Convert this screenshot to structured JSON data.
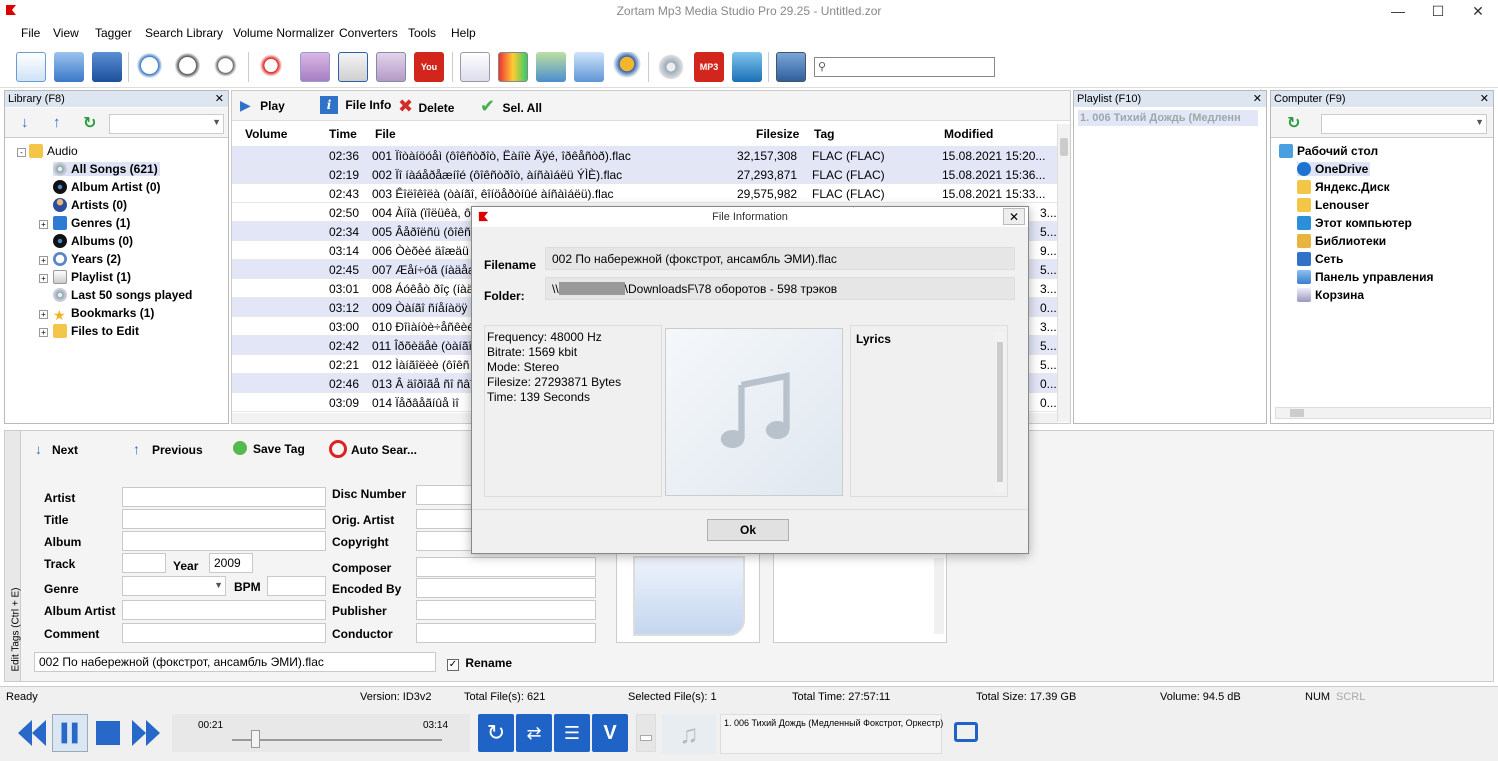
{
  "window": {
    "title": "Zortam Mp3 Media Studio Pro 29.25 - Untitled.zor"
  },
  "menu": [
    "File",
    "View",
    "Tagger",
    "Search Library",
    "Volume Normalizer",
    "Converters",
    "Tools",
    "Help"
  ],
  "library": {
    "header": "Library (F8)",
    "tree": [
      {
        "label": "Audio",
        "level": 0
      },
      {
        "label": "All Songs (621)",
        "level": 1
      },
      {
        "label": "Album Artist (0)",
        "level": 1
      },
      {
        "label": "Artists (0)",
        "level": 1
      },
      {
        "label": "Genres (1)",
        "level": 1
      },
      {
        "label": "Albums (0)",
        "level": 1
      },
      {
        "label": "Years (2)",
        "level": 1
      },
      {
        "label": "Playlist (1)",
        "level": 1
      },
      {
        "label": "Last 50 songs played",
        "level": 1
      },
      {
        "label": "Bookmarks (1)",
        "level": 1
      },
      {
        "label": "Files to Edit",
        "level": 1
      }
    ]
  },
  "actions": {
    "play": "Play",
    "file_info": "File Info",
    "delete": "Delete",
    "sel_all": "Sel. All"
  },
  "columns": {
    "volume": "Volume",
    "time": "Time",
    "file": "File",
    "filesize": "Filesize",
    "tag": "Tag",
    "modified": "Modified"
  },
  "rows": [
    {
      "time": "02:36",
      "file": "001 Ïîòàíöóåì (ôîêñòðîò, Ëàíîè Äÿé, îðêåñòð).flac",
      "size": "32,157,308",
      "tag": "FLAC (FLAC)",
      "mod": "15.08.2021 15:20..."
    },
    {
      "time": "02:19",
      "file": "002 Ïî íàáåðåæíîé (ôîêñòðîò, àíñàìáëü ÝÌÈ).flac",
      "size": "27,293,871",
      "tag": "FLAC (FLAC)",
      "mod": "15.08.2021 15:36..."
    },
    {
      "time": "02:43",
      "file": "003 Êîëîêîëà (òàíãî, êîíöåðòíûé àíñàìáëü).flac",
      "size": "29,575,982",
      "tag": "FLAC (FLAC)",
      "mod": "15.08.2021 15:33..."
    },
    {
      "time": "02:50",
      "file": "004 Àíîà (ïîëüêà, ôîð",
      "size": "",
      "tag": "",
      "mod": "3..."
    },
    {
      "time": "02:34",
      "file": "005 Âåðîëñü (ôîêñ",
      "size": "",
      "tag": "",
      "mod": "5..."
    },
    {
      "time": "03:14",
      "file": "006 Òèõèé äîæäü",
      "size": "",
      "tag": "",
      "mod": "9..."
    },
    {
      "time": "02:45",
      "file": "007 Æåí÷óã (íàäåæ",
      "size": "",
      "tag": "",
      "mod": "5..."
    },
    {
      "time": "03:01",
      "file": "008 Áóêåò ðîç (íàä",
      "size": "",
      "tag": "",
      "mod": "3..."
    },
    {
      "time": "03:12",
      "file": "009 Òàíãî ñíåíàöÿ",
      "size": "",
      "tag": "",
      "mod": "0..."
    },
    {
      "time": "03:00",
      "file": "010 Ðîìàíòè÷åñêèé",
      "size": "",
      "tag": "",
      "mod": "3..."
    },
    {
      "time": "02:42",
      "file": "011 Îðõèäåè (òàíãî",
      "size": "",
      "tag": "",
      "mod": "5..."
    },
    {
      "time": "02:21",
      "file": "012 Ìàíãîëèè (ôîêñ",
      "size": "",
      "tag": "",
      "mod": "5..."
    },
    {
      "time": "02:46",
      "file": "013 Â äîðîãå ñî ñâîåé",
      "size": "",
      "tag": "",
      "mod": "0..."
    },
    {
      "time": "03:09",
      "file": "014 Ïåðâåãíûå ìî",
      "size": "",
      "tag": "",
      "mod": "0..."
    }
  ],
  "playlist": {
    "header": "Playlist (F10)",
    "item": "1. 006 Тихий Дождь (Медленн"
  },
  "computer": {
    "header": "Computer (F9)",
    "tree": [
      "Рабочий стол",
      "OneDrive",
      "Яндекс.Диск",
      "Lenouser",
      "Этот компьютер",
      "Библиотеки",
      "Сеть",
      "Панель управления",
      "Корзина"
    ]
  },
  "editor": {
    "next": "Next",
    "previous": "Previous",
    "save_tag": "Save Tag",
    "auto_search": "Auto Sear...",
    "side_label": "Edit Tags (Ctrl + E)",
    "labels": {
      "artist": "Artist",
      "title": "Title",
      "album": "Album",
      "track": "Track",
      "year": "Year",
      "genre": "Genre",
      "bpm": "BPM",
      "album_artist": "Album Artist",
      "comment": "Comment",
      "disc_number": "Disc Number",
      "orig_artist": "Orig. Artist",
      "copyright": "Copyright",
      "composer": "Composer",
      "encoded_by": "Encoded By",
      "publisher": "Publisher",
      "conductor": "Conductor"
    },
    "year_value": "2009",
    "filename_value": "002 По набережной (фокстрот, ансамбль ЭМИ).flac",
    "rename": "Rename"
  },
  "dialog": {
    "title": "File Information",
    "filename_label": "Filename",
    "filename": "002 По набережной (фокстрот, ансамбль ЭМИ).flac",
    "folder_label": "Folder:",
    "folder_start": "\\\\",
    "folder_end": "\\DownloadsF\\78 оборотов - 598 трэков",
    "frequency": "Frequency: 48000 Hz",
    "bitrate": "Bitrate: 1569 kbit",
    "mode": "Mode: Stereo",
    "filesize": "Filesize: 27293871 Bytes",
    "time": "Time: 139 Seconds",
    "lyrics": "Lyrics",
    "ok": "Ok"
  },
  "status": {
    "ready": "Ready",
    "version": "Version: ID3v2",
    "total_files": "Total File(s): 621",
    "selected": "Selected File(s): 1",
    "total_time": "Total Time: 27:57:11",
    "total_size": "Total Size: 17.39 GB",
    "volume": "Volume: 94.5 dB",
    "num": "NUM",
    "scrl": "SCRL"
  },
  "player": {
    "elapsed": "00:21",
    "duration": "03:14",
    "progress": 0.11,
    "now_playing": "1. 006 Тихий Дождь (Медленный Фокстрот, Оркестр)"
  }
}
